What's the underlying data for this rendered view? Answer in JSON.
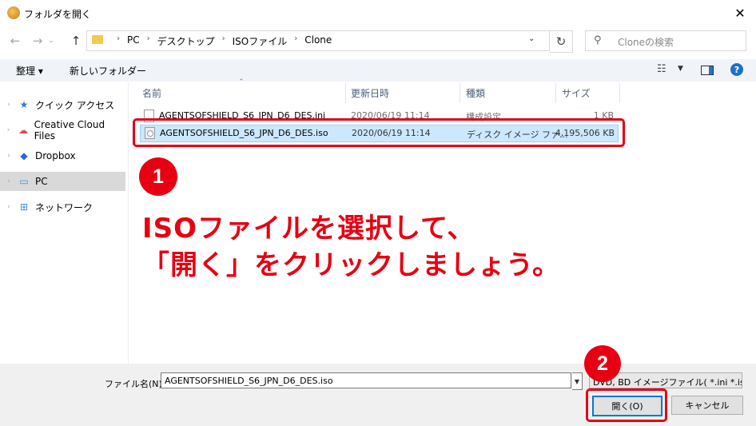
{
  "window": {
    "title": "フォルダを開く"
  },
  "nav": {
    "breadcrumb": [
      "PC",
      "デスクトップ",
      "ISOファイル",
      "Clone"
    ],
    "search_placeholder": "Cloneの検索"
  },
  "toolbar": {
    "organize_label": "整理 ▾",
    "new_folder_label": "新しいフォルダー"
  },
  "sidebar": {
    "items": [
      {
        "label": "クイック アクセス"
      },
      {
        "label": "Creative Cloud Files"
      },
      {
        "label": "Dropbox"
      },
      {
        "label": "PC"
      },
      {
        "label": "ネットワーク"
      }
    ]
  },
  "columns": {
    "name": "名前",
    "date": "更新日時",
    "type": "種類",
    "size": "サイズ"
  },
  "files": [
    {
      "name": "AGENTSOFSHIELD_S6_JPN_D6_DES.ini",
      "date": "2020/06/19 11:14",
      "type": "構成設定",
      "size": "1 KB"
    },
    {
      "name": "AGENTSOFSHIELD_S6_JPN_D6_DES.iso",
      "date": "2020/06/19 11:14",
      "type": "ディスク イメージ ファ...",
      "size": "4,195,506 KB"
    }
  ],
  "annotations": {
    "badge1": "1",
    "badge2": "2",
    "instruction": "ISOファイルを選択して、\n「開く」をクリックしましょう。",
    "accent_color": "#e60012"
  },
  "bottom": {
    "filename_label": "ファイル名(N):",
    "filename_value": "AGENTSOFSHIELD_S6_JPN_D6_DES.iso",
    "filter_value": "DVD, BD イメージファイル( *.ini *.iso",
    "open_label": "開く(O)",
    "cancel_label": "キャンセル"
  }
}
